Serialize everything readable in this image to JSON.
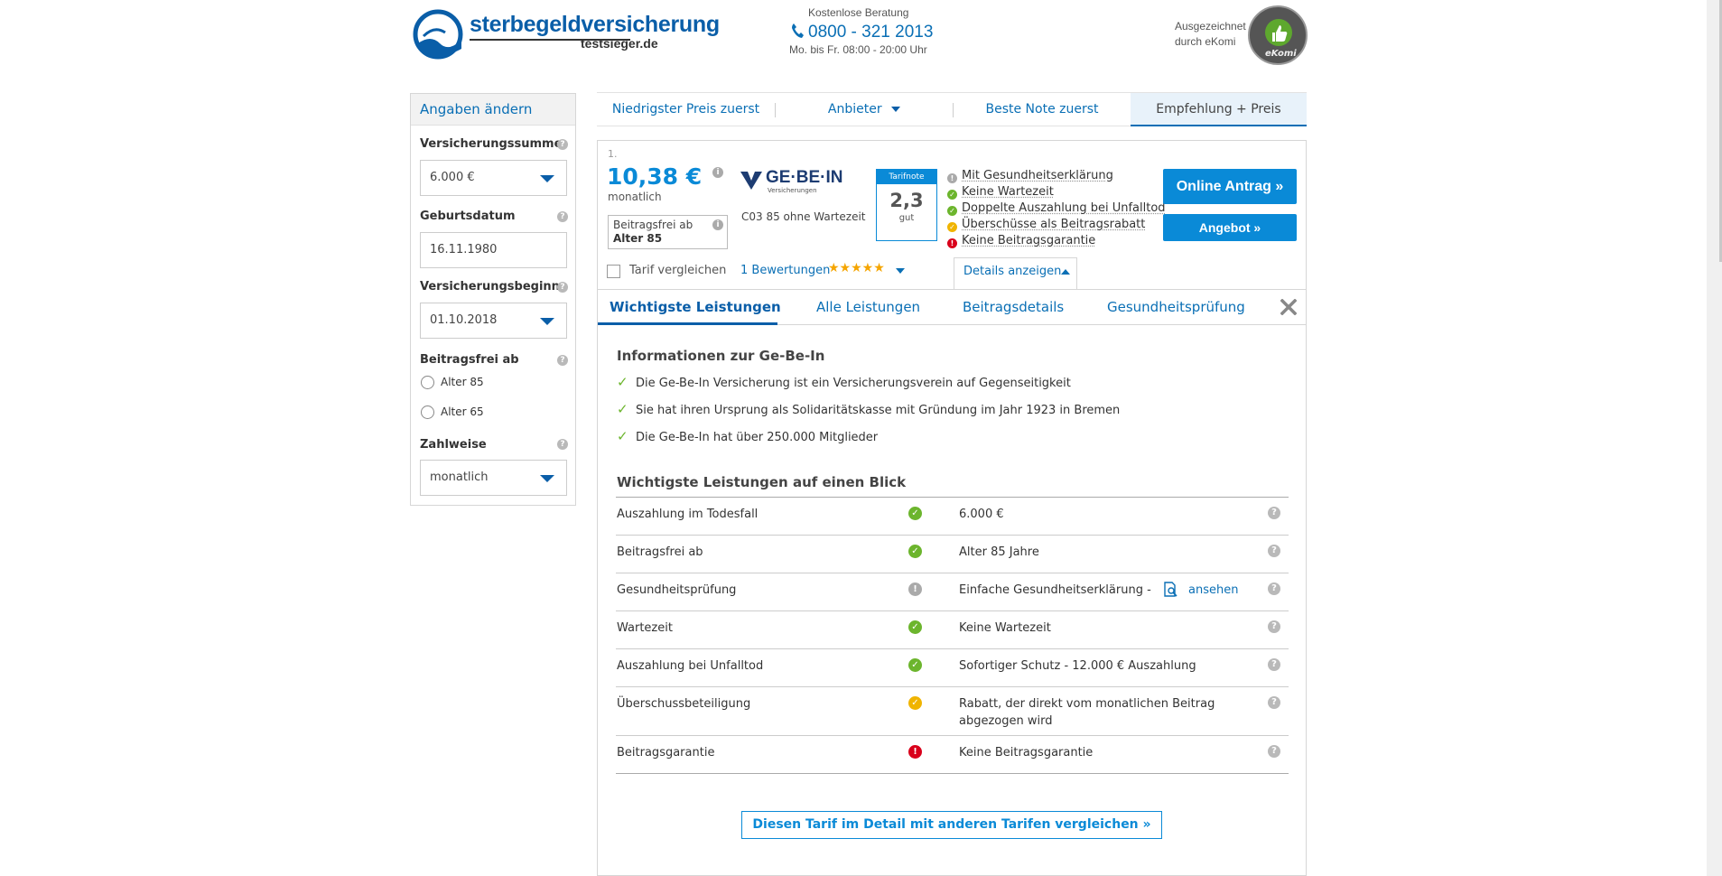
{
  "header": {
    "logo_main": "sterbegeldversicherung",
    "logo_sub": "testsieger.de",
    "contact_label": "Kostenlose Beratung",
    "phone": "0800 - 321 2013",
    "hours": "Mo. bis Fr. 08:00 - 20:00 Uhr",
    "award_line1": "Ausgezeichnet",
    "award_line2": "durch eKomi",
    "badge_text": "eKomi"
  },
  "sidebar": {
    "title": "Angaben ändern",
    "sum_label": "Versicherungssumme",
    "sum_value": "6.000 €",
    "birth_label": "Geburtsdatum",
    "birth_value": "16.11.1980",
    "start_label": "Versicherungsbeginn",
    "start_value": "01.10.2018",
    "free_label": "Beitragsfrei ab",
    "free_opt1": "Alter 85",
    "free_opt2": "Alter 65",
    "pay_label": "Zahlweise",
    "pay_value": "monatlich"
  },
  "sort": {
    "tab1": "Niedrigster Preis zuerst",
    "tab2": "Anbieter",
    "tab3": "Beste Note zuerst",
    "tab4": "Empfehlung + Preis"
  },
  "result": {
    "rank": "1.",
    "price": "10,38 €",
    "period": "monatlich",
    "free_label": "Beitragsfrei ab",
    "free_value": "Alter 85",
    "provider_logo": "GE·BE·IN",
    "provider_logo_sub": "Versicherungen",
    "tariff": "C03 85 ohne Wartezeit",
    "grade_label": "Tarifnote",
    "grade_value": "2,3",
    "grade_text": "gut",
    "features": [
      "Mit Gesundheitserklärung",
      "Keine Wartezeit",
      "Doppelte Auszahlung bei Unfalltod",
      "Überschüsse als Beitragsrabatt",
      "Keine Beitragsgarantie"
    ],
    "online_button": "Online Antrag »",
    "offer_button": "Angebot »",
    "compare_label": "Tarif vergleichen",
    "reviews": "1 Bewertungen",
    "stars": "★★★★★",
    "details": "Details anzeigen"
  },
  "detail_tabs": {
    "tab1": "Wichtigste Leistungen",
    "tab2": "Alle Leistungen",
    "tab3": "Beitragsdetails",
    "tab4": "Gesundheitsprüfung"
  },
  "info": {
    "title": "Informationen zur Ge-Be-In",
    "items": [
      "Die Ge-Be-In Versicherung ist ein Versicherungsverein auf Gegenseitigkeit",
      "Sie hat ihren Ursprung als Solidaritätskasse mit Gründung im Jahr 1923 in Bremen",
      "Die Ge-Be-In hat über 250.000 Mitglieder"
    ]
  },
  "benefits": {
    "title": "Wichtigste Leistungen auf einen Blick",
    "rows": [
      {
        "label": "Auszahlung im Todesfall",
        "value": "6.000 €"
      },
      {
        "label": "Beitragsfrei ab",
        "value": "Alter 85 Jahre"
      },
      {
        "label": "Gesundheitsprüfung",
        "value": "Einfache Gesundheitserklärung  -",
        "link": "ansehen"
      },
      {
        "label": "Wartezeit",
        "value": "Keine Wartezeit"
      },
      {
        "label": "Auszahlung bei Unfalltod",
        "value": "Sofortiger Schutz - 12.000 € Auszahlung"
      },
      {
        "label": "Überschussbeteiligung",
        "value": "Rabatt, der direkt vom monatlichen Beitrag",
        "value2": "abgezogen wird"
      },
      {
        "label": "Beitragsgarantie",
        "value": "Keine Beitragsgarantie"
      }
    ]
  },
  "compare_button": "Diesen Tarif im Detail mit anderen Tarifen vergleichen »",
  "colors": {
    "brand": "#0a6fb5",
    "button": "#0a8ad7",
    "ok": "#6cb52d",
    "warn": "#f0b400",
    "bad": "#d9001b"
  }
}
